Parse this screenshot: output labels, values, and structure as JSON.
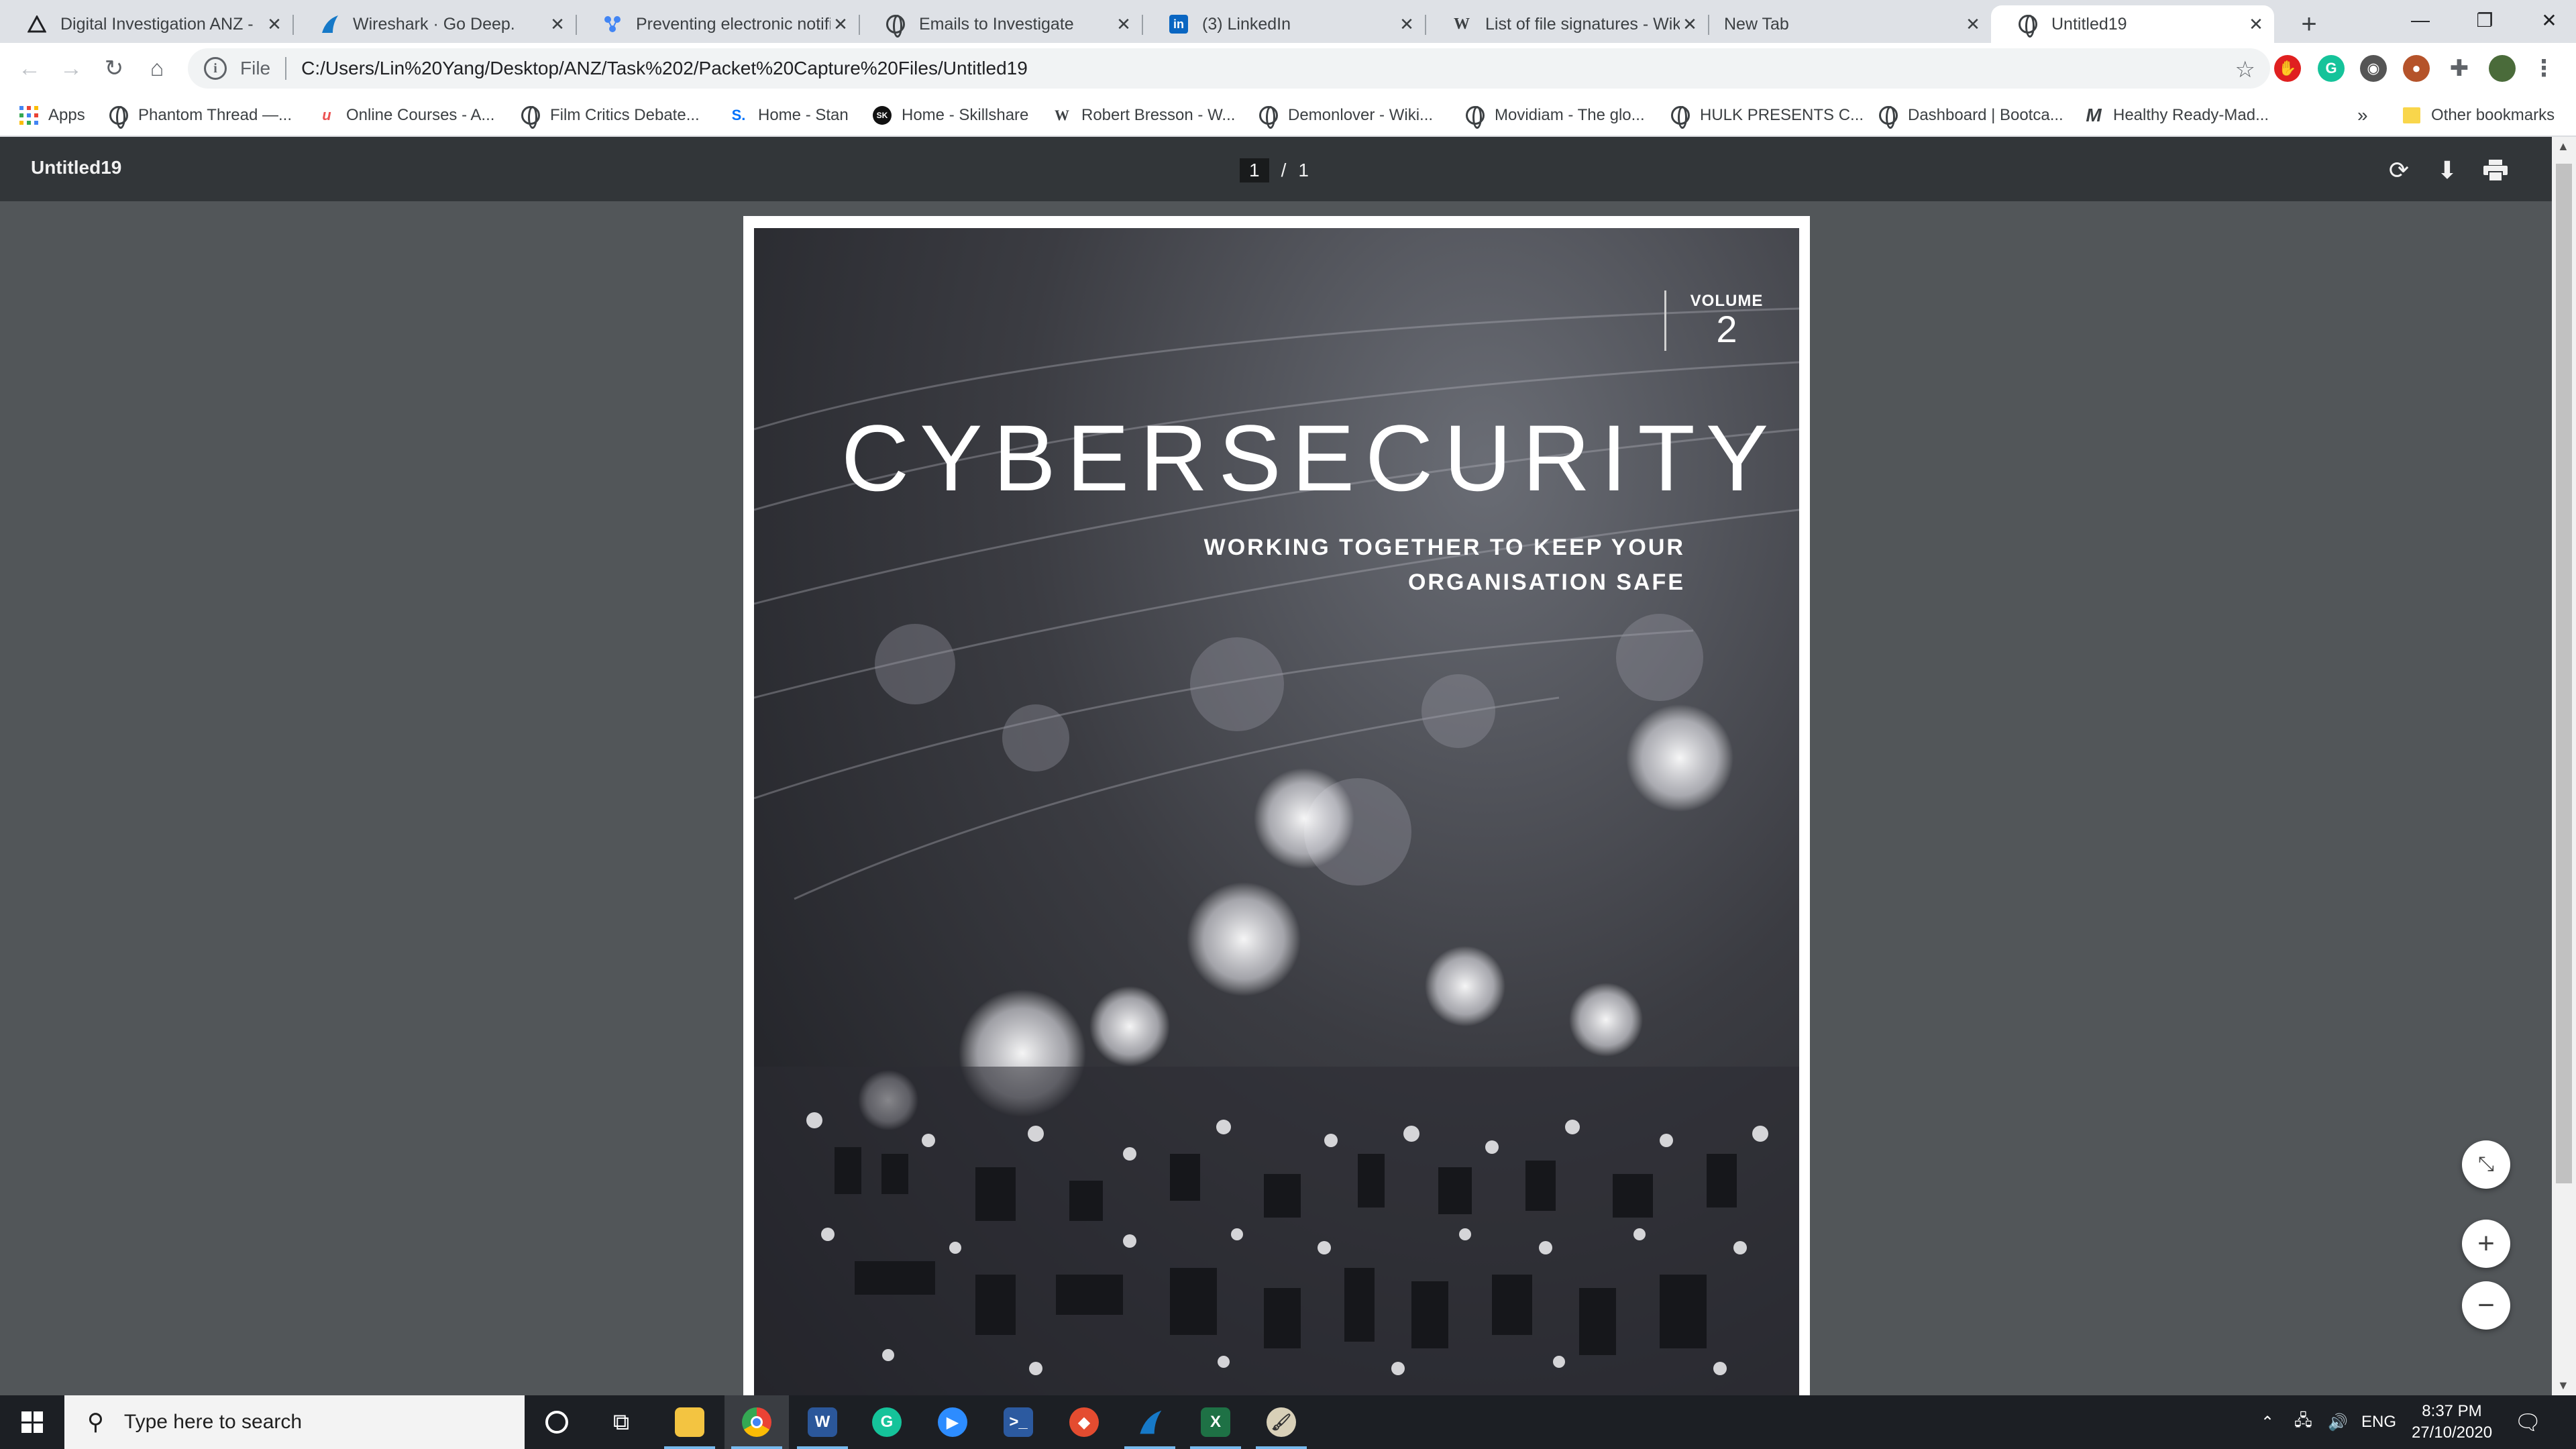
{
  "browser": {
    "tabs": [
      {
        "title": "Digital Investigation ANZ - ",
        "icon": "triangle-logo-icon",
        "active": false
      },
      {
        "title": "Wireshark · Go Deep.",
        "icon": "wireshark-fin-icon",
        "active": false
      },
      {
        "title": "Preventing electronic notific",
        "icon": "network-icon",
        "active": false
      },
      {
        "title": "Emails to Investigate",
        "icon": "globe-icon",
        "active": false
      },
      {
        "title": "(3) LinkedIn",
        "icon": "linkedin-icon",
        "active": false
      },
      {
        "title": "List of file signatures - Wiki",
        "icon": "wikipedia-icon",
        "active": false
      },
      {
        "title": "New Tab",
        "icon": "",
        "active": false
      },
      {
        "title": "Untitled19",
        "icon": "globe-icon",
        "active": true
      }
    ],
    "address": {
      "scheme_label": "File",
      "url": "C:/Users/Lin%20Yang/Desktop/ANZ/Task%202/Packet%20Capture%20Files/Untitled19"
    },
    "bookmarks": [
      {
        "label": "Apps",
        "icon": "apps-grid-icon"
      },
      {
        "label": "Phantom Thread —...",
        "icon": "globe-icon"
      },
      {
        "label": "Online Courses - A...",
        "icon": "udemy-icon"
      },
      {
        "label": "Film Critics Debate...",
        "icon": "globe-icon"
      },
      {
        "label": "Home - Stan",
        "icon": "stan-icon"
      },
      {
        "label": "Home - Skillshare",
        "icon": "skillshare-icon"
      },
      {
        "label": "Robert Bresson - W...",
        "icon": "wikipedia-icon"
      },
      {
        "label": "Demonlover - Wiki...",
        "icon": "globe-icon"
      },
      {
        "label": "Movidiam - The glo...",
        "icon": "globe-icon"
      },
      {
        "label": "HULK PRESENTS C...",
        "icon": "globe-icon"
      },
      {
        "label": "Dashboard | Bootca...",
        "icon": "globe-icon"
      },
      {
        "label": "Healthy Ready-Mad...",
        "icon": "m-logo-icon"
      }
    ],
    "overflow_label": "»",
    "other_bookmarks": "Other bookmarks"
  },
  "pdf": {
    "title": "Untitled19",
    "current_page": "1",
    "page_separator": "/",
    "total_pages": "1",
    "cover": {
      "volume_label": "VOLUME",
      "volume_number": "2",
      "title": "CYBERSECURITY",
      "subtitle_line1": "WORKING TOGETHER TO KEEP YOUR",
      "subtitle_line2": "ORGANISATION SAFE"
    }
  },
  "taskbar": {
    "search_placeholder": "Type here to search",
    "language": "ENG",
    "time": "8:37 PM",
    "date": "27/10/2020"
  },
  "colors": {
    "tabstrip": "#dee1e6",
    "pdf_toolbar": "#323639",
    "pdf_background": "#525659",
    "taskbar": "#1c1f24",
    "taskbar_accent": "#76b9ed"
  }
}
